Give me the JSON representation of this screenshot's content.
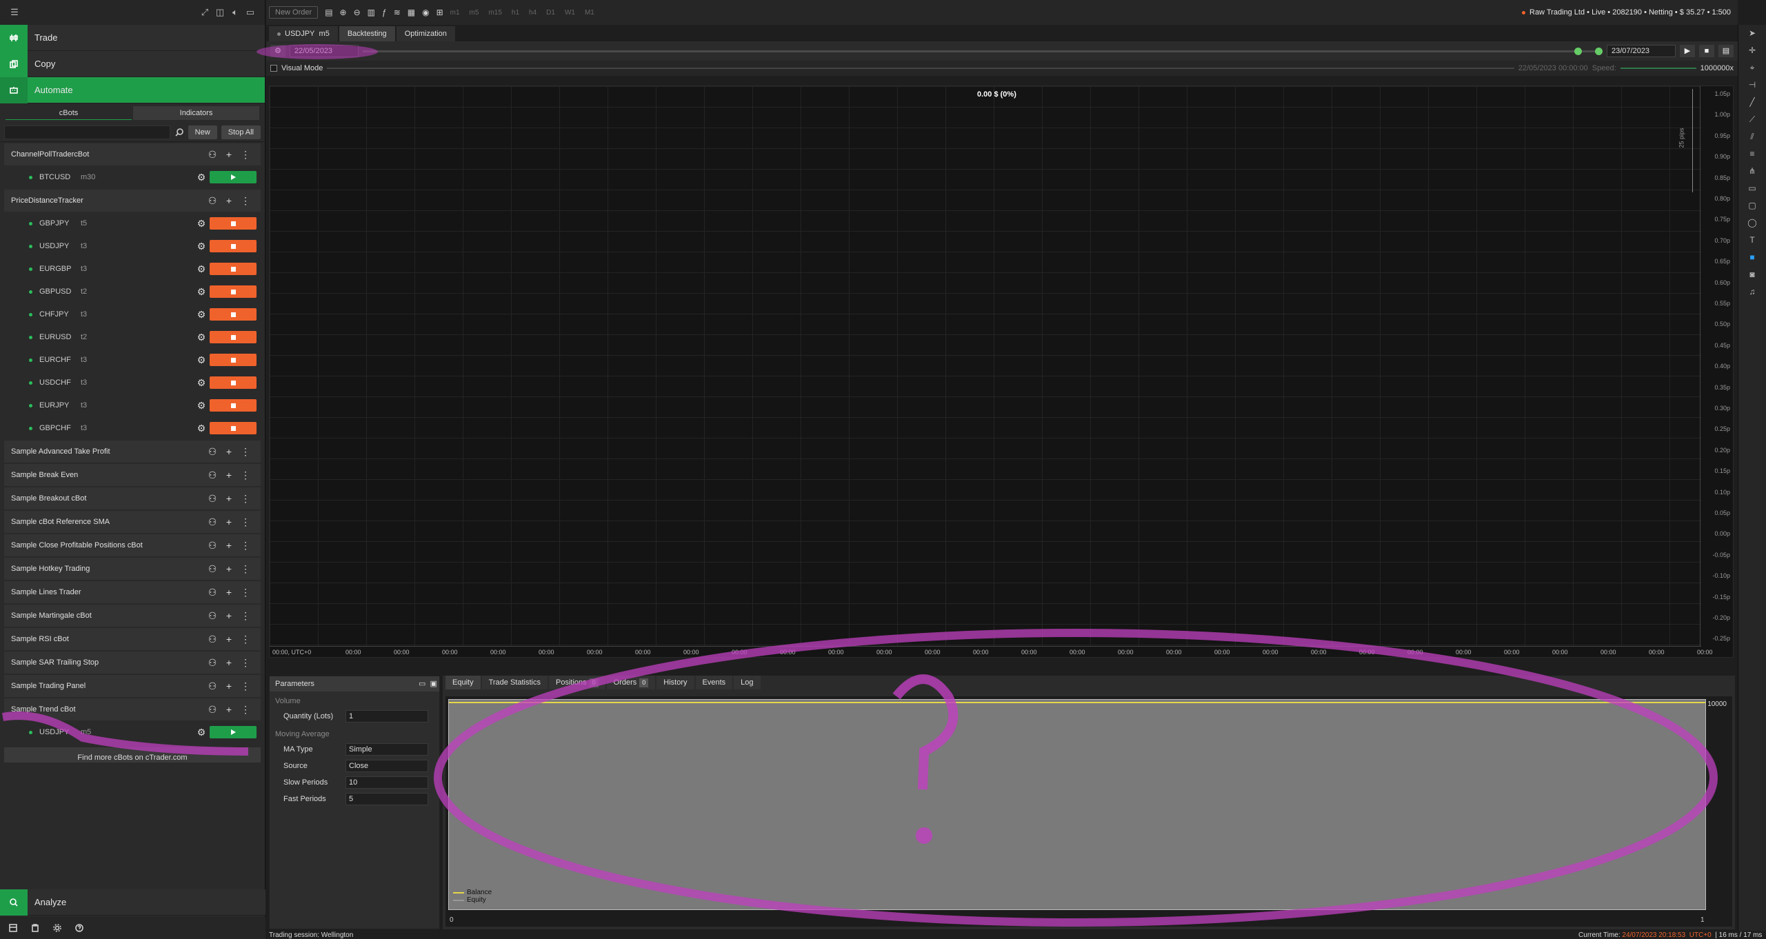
{
  "nav": {
    "trade": "Trade",
    "copy": "Copy",
    "automate": "Automate",
    "analyze": "Analyze"
  },
  "subtabs": {
    "cbots": "cBots",
    "indicators": "Indicators"
  },
  "search": {
    "new_label": "New",
    "stop_all_label": "Stop All"
  },
  "bots": [
    {
      "name": "ChannelPollTradercBot",
      "instances": [
        {
          "symbol": "BTCUSD",
          "tf": "m30",
          "state": "play"
        }
      ]
    },
    {
      "name": "PriceDistanceTracker",
      "instances": [
        {
          "symbol": "GBPJPY",
          "tf": "t5",
          "state": "stop"
        },
        {
          "symbol": "USDJPY",
          "tf": "t3",
          "state": "stop"
        },
        {
          "symbol": "EURGBP",
          "tf": "t3",
          "state": "stop"
        },
        {
          "symbol": "GBPUSD",
          "tf": "t2",
          "state": "stop"
        },
        {
          "symbol": "CHFJPY",
          "tf": "t3",
          "state": "stop"
        },
        {
          "symbol": "EURUSD",
          "tf": "t2",
          "state": "stop"
        },
        {
          "symbol": "EURCHF",
          "tf": "t3",
          "state": "stop"
        },
        {
          "symbol": "USDCHF",
          "tf": "t3",
          "state": "stop"
        },
        {
          "symbol": "EURJPY",
          "tf": "t3",
          "state": "stop"
        },
        {
          "symbol": "GBPCHF",
          "tf": "t3",
          "state": "stop"
        }
      ]
    },
    {
      "name": "Sample Advanced Take Profit",
      "instances": []
    },
    {
      "name": "Sample Break Even",
      "instances": []
    },
    {
      "name": "Sample Breakout cBot",
      "instances": []
    },
    {
      "name": "Sample cBot Reference SMA",
      "instances": []
    },
    {
      "name": "Sample Close Profitable Positions cBot",
      "instances": []
    },
    {
      "name": "Sample Hotkey Trading",
      "instances": []
    },
    {
      "name": "Sample Lines Trader",
      "instances": []
    },
    {
      "name": "Sample Martingale cBot",
      "instances": []
    },
    {
      "name": "Sample RSI cBot",
      "instances": []
    },
    {
      "name": "Sample SAR Trailing Stop",
      "instances": []
    },
    {
      "name": "Sample Trading Panel",
      "instances": []
    },
    {
      "name": "Sample Trend cBot",
      "instances": [
        {
          "symbol": "USDJPY",
          "tf": "m5",
          "state": "play"
        }
      ]
    }
  ],
  "find_more": "Find more cBots on cTrader.com",
  "toolbar": {
    "new_order": "New Order",
    "timeframes": [
      "m1",
      "m5",
      "m15",
      "h1",
      "h4",
      "D1",
      "W1",
      "M1"
    ]
  },
  "account": "Raw Trading Ltd • Live • 2082190 • Netting • $ 35.27 • 1:500",
  "doc_tabs": {
    "symbol": "USDJPY",
    "tf": "m5",
    "backtesting": "Backtesting",
    "optimization": "Optimization"
  },
  "dates": {
    "start": "22/05/2023",
    "end": "23/07/2023"
  },
  "visual": {
    "label": "Visual Mode",
    "time": "22/05/2023 00:00:00",
    "speed_label": "Speed:",
    "speed_value": "1000000x"
  },
  "chart": {
    "pnl": "0.00 $ (0%)",
    "y_ticks": [
      "1.05p",
      "1.00p",
      "0.95p",
      "0.90p",
      "0.85p",
      "0.80p",
      "0.75p",
      "0.70p",
      "0.65p",
      "0.60p",
      "0.55p",
      "0.50p",
      "0.45p",
      "0.40p",
      "0.35p",
      "0.30p",
      "0.25p",
      "0.20p",
      "0.15p",
      "0.10p",
      "0.05p",
      "0.00p",
      "-0.05p",
      "-0.10p",
      "-0.15p",
      "-0.20p",
      "-0.25p"
    ],
    "pips": "25 pips",
    "x_first": "00:00, UTC+0",
    "x_tick": "00:00"
  },
  "params": {
    "title": "Parameters",
    "group1": "Volume",
    "qty_label": "Quantity (Lots)",
    "qty": "1",
    "group2": "Moving Average",
    "ma_type_label": "MA Type",
    "ma_type": "Simple",
    "source_label": "Source",
    "source": "Close",
    "slow_label": "Slow Periods",
    "slow": "10",
    "fast_label": "Fast Periods",
    "fast": "5"
  },
  "results": {
    "tabs": {
      "equity": "Equity",
      "stats": "Trade Statistics",
      "positions": "Positions",
      "orders": "Orders",
      "history": "History",
      "events": "Events",
      "log": "Log"
    },
    "positions_count": "0",
    "orders_count": "0",
    "y_label": "10000",
    "x0": "0",
    "x1": "1",
    "legend": {
      "balance": "Balance",
      "equity": "Equity"
    }
  },
  "status": {
    "session": "Trading session: Wellington",
    "current_time_label": "Current Time:",
    "current_time": "24/07/2023 20:18:53",
    "tz": "UTC+0",
    "latency": "| 16 ms / 17 ms"
  },
  "colors": {
    "green": "#1f9e4a",
    "orange": "#f0622c",
    "annotation": "#c040c0"
  }
}
